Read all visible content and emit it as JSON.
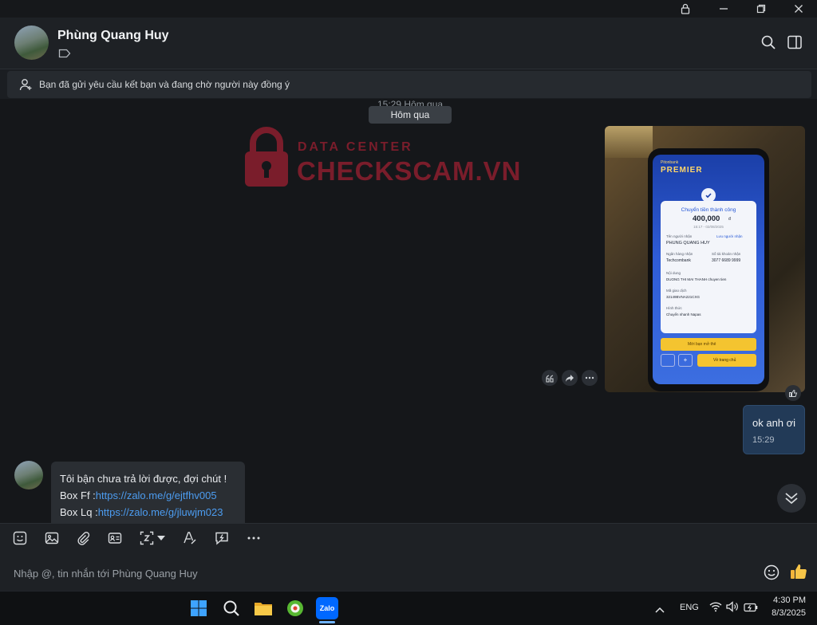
{
  "header": {
    "contact_name": "Phùng Quang Huy"
  },
  "notice": {
    "text": "Bạn đã gửi yêu cầu kết bạn và đang chờ người này đồng ý"
  },
  "chat": {
    "date_ghost": "15:29 Hôm qua",
    "date_pill": "Hôm qua",
    "watermark": {
      "line1": "DATA CENTER",
      "line2": "CHECKSCAM.VN"
    },
    "photo_receipt": {
      "brand_small": "Pitonbank",
      "brand": "PREMIER",
      "status": "Chuyển tiền thành công",
      "amount": "400,000",
      "currency": "đ",
      "datetime": "15:17 - 02/08/2025",
      "receiver_label": "Tên người nhận",
      "save_receiver": "Lưu người nhận",
      "receiver_name": "PHUNG QUANG HUY",
      "bank_label": "Ngân hàng nhận",
      "account_label": "Số tài khoản nhận",
      "bank_name": "Techcombank",
      "account_number": "3077 6689 9999",
      "content_label": "Nội dung",
      "content": "DUONG THI MAI THANH chuyen tien",
      "txn_label": "Mã giao dịch",
      "txn_code": "32149BVNA221CXG",
      "method_label": "Hình thức",
      "method": "Chuyển nhanh Napas",
      "banner": "Mời bạn mở thẻ",
      "home_button": "Về trang chủ"
    },
    "outgoing": {
      "text": "ok anh ơi",
      "time": "15:29"
    },
    "incoming": {
      "line1": "Tôi bận chưa trả lời được, đợi chút !",
      "box_ff_label": "Box Ff :",
      "box_ff_link": "https://zalo.me/g/ejtfhv005",
      "box_lq_label": "Box Lq :",
      "box_lq_link": "https://zalo.me/g/jluwjm023"
    }
  },
  "composer": {
    "placeholder": "Nhập @, tin nhắn tới Phùng Quang Huy"
  },
  "taskbar": {
    "zalo_label": "Zalo",
    "language": "ENG",
    "time": "4:30 PM",
    "date": "8/3/2025"
  },
  "colors": {
    "accent_link": "#4c9cf0",
    "outgoing_bubble": "#223a57",
    "watermark": "#7a1d2b"
  },
  "icons": [
    "lock-icon",
    "minimize-icon",
    "restore-icon",
    "close-icon",
    "tag-icon",
    "search-icon",
    "panel-icon",
    "add-friend-icon",
    "quote-icon",
    "forward-icon",
    "more-icon",
    "like-icon",
    "chevron-double-down-icon",
    "sticker-icon",
    "image-icon",
    "attachment-icon",
    "contact-card-icon",
    "screenshot-icon",
    "caret-down-icon",
    "text-format-icon",
    "quick-message-icon",
    "emoji-icon",
    "thumbs-up-icon",
    "windows-start-icon",
    "file-explorer-icon",
    "wifi-icon",
    "volume-icon",
    "battery-icon"
  ]
}
